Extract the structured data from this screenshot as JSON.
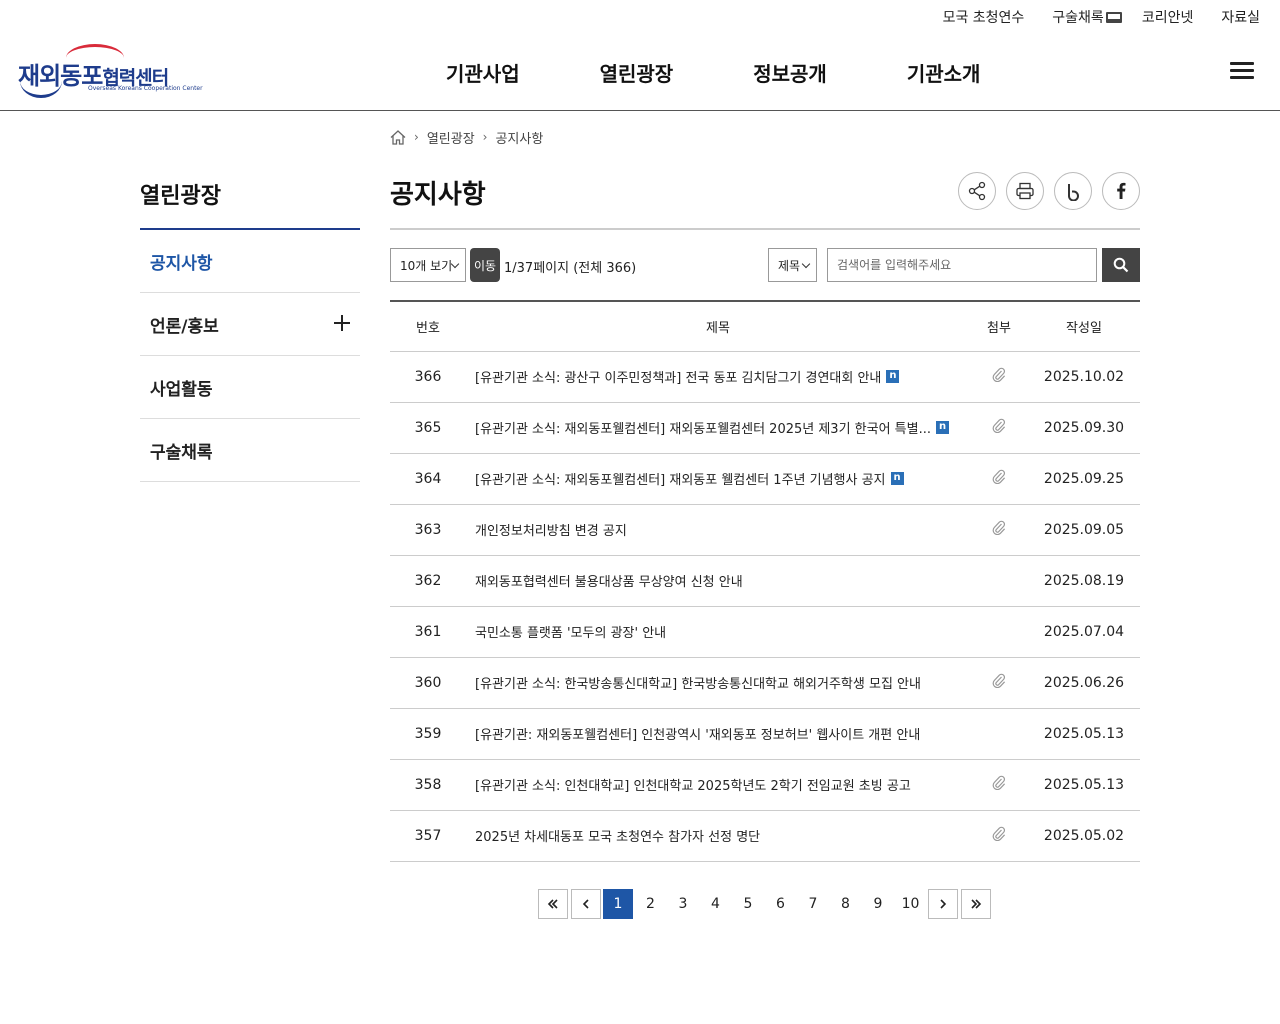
{
  "util_links": [
    "모국 초청연수",
    "구술채록",
    "코리안넷",
    "자료실"
  ],
  "logo": {
    "main": "재외동포",
    "sub": "협력센터",
    "en": "Overseas Koreans Cooperation Center"
  },
  "gnb": [
    "기관사업",
    "열린광장",
    "정보공개",
    "기관소개"
  ],
  "sidebar": {
    "title": "열린광장",
    "items": [
      {
        "label": "공지사항"
      },
      {
        "label": "언론/홍보"
      },
      {
        "label": "사업활동"
      },
      {
        "label": "구술채록"
      }
    ]
  },
  "breadcrumb": [
    "열린광장",
    "공지사항"
  ],
  "page_title": "공지사항",
  "controls": {
    "view_count": "10개 보기",
    "go_label": "이동",
    "page_info": "1/37페이지 (전체 366)",
    "search_field": "제목",
    "search_placeholder": "검색어를 입력해주세요"
  },
  "table": {
    "headers": [
      "번호",
      "제목",
      "첨부",
      "작성일"
    ],
    "rows": [
      {
        "num": "366",
        "title": "[유관기관 소식: 광산구 이주민정책과] 전국 동포 김치담그기 경연대회 안내",
        "new": true,
        "attach": true,
        "date": "2025.10.02"
      },
      {
        "num": "365",
        "title": "[유관기관 소식: 재외동포웰컴센터] 재외동포웰컴센터 2025년 제3기 한국어 특별...",
        "new": true,
        "attach": true,
        "date": "2025.09.30"
      },
      {
        "num": "364",
        "title": "[유관기관 소식: 재외동포웰컴센터] 재외동포 웰컴센터 1주년 기념행사 공지",
        "new": true,
        "attach": true,
        "date": "2025.09.25"
      },
      {
        "num": "363",
        "title": "개인정보처리방침 변경 공지",
        "new": false,
        "attach": true,
        "date": "2025.09.05"
      },
      {
        "num": "362",
        "title": "재외동포협력센터 불용대상품 무상양여 신청 안내",
        "new": false,
        "attach": false,
        "date": "2025.08.19"
      },
      {
        "num": "361",
        "title": "국민소통 플랫폼 '모두의 광장' 안내",
        "new": false,
        "attach": false,
        "date": "2025.07.04"
      },
      {
        "num": "360",
        "title": "[유관기관 소식: 한국방송통신대학교] 한국방송통신대학교 해외거주학생 모집 안내",
        "new": false,
        "attach": true,
        "date": "2025.06.26"
      },
      {
        "num": "359",
        "title": "[유관기관: 재외동포웰컴센터] 인천광역시 '재외동포 정보허브' 웹사이트 개편 안내",
        "new": false,
        "attach": false,
        "date": "2025.05.13"
      },
      {
        "num": "358",
        "title": "[유관기관 소식: 인천대학교] 인천대학교 2025학년도 2학기 전임교원 초빙 공고",
        "new": false,
        "attach": true,
        "date": "2025.05.13"
      },
      {
        "num": "357",
        "title": "2025년 차세대동포 모국 초청연수 참가자 선정 명단",
        "new": false,
        "attach": true,
        "date": "2025.05.02"
      }
    ]
  },
  "pagination": {
    "pages": [
      "1",
      "2",
      "3",
      "4",
      "5",
      "6",
      "7",
      "8",
      "9",
      "10"
    ],
    "current": "1",
    "new_badge": "n"
  },
  "colors": {
    "brand_blue": "#1e3c8c",
    "active_blue": "#1e56a6",
    "brand_red": "#d92b3a",
    "button_dark": "#444444"
  }
}
